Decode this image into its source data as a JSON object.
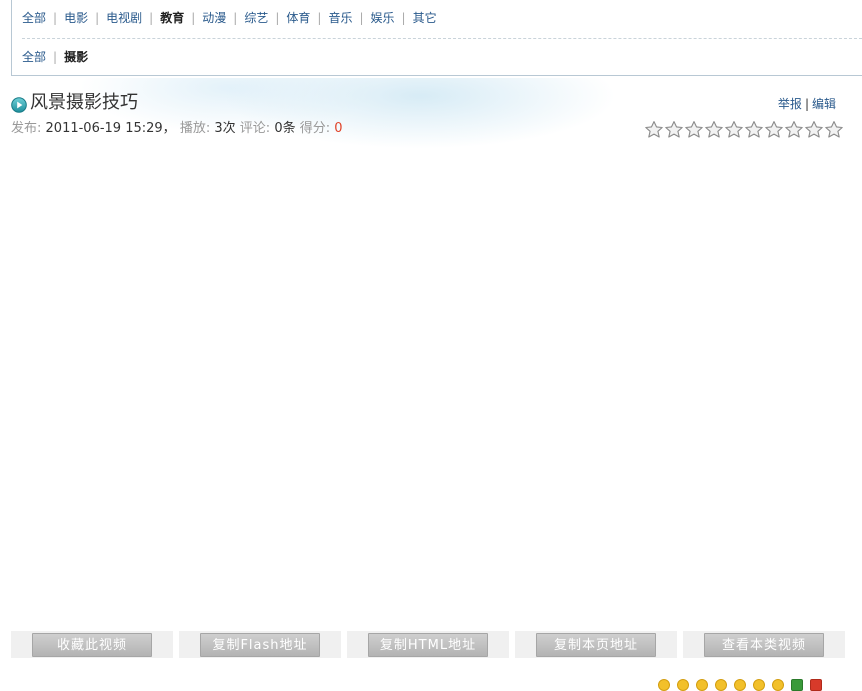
{
  "categories": {
    "row1": [
      {
        "label": "全部",
        "active": false
      },
      {
        "label": "电影",
        "active": false
      },
      {
        "label": "电视剧",
        "active": false
      },
      {
        "label": "教育",
        "active": true
      },
      {
        "label": "动漫",
        "active": false
      },
      {
        "label": "综艺",
        "active": false
      },
      {
        "label": "体育",
        "active": false
      },
      {
        "label": "音乐",
        "active": false
      },
      {
        "label": "娱乐",
        "active": false
      },
      {
        "label": "其它",
        "active": false
      }
    ],
    "row2": [
      {
        "label": "全部",
        "active": false
      },
      {
        "label": "摄影",
        "active": true
      }
    ],
    "separator": "|"
  },
  "video": {
    "title": "风景摄影技巧",
    "publish_label": "发布:",
    "publish_value": "2011-06-19 15:29，",
    "plays_label": "播放:",
    "plays_value": "3次",
    "comments_label": "评论:",
    "comments_value": "0条",
    "score_label": "得分:",
    "score_value": "0"
  },
  "actions": {
    "report": "举报",
    "separator": "|",
    "edit": "编辑"
  },
  "rating": {
    "max": 10,
    "value": 0
  },
  "buttons": [
    {
      "label": "收藏此视频"
    },
    {
      "label": "复制Flash地址"
    },
    {
      "label": "复制HTML地址"
    },
    {
      "label": "复制本页地址"
    },
    {
      "label": "查看本类视频"
    }
  ],
  "colors": {
    "link": "#2a5a8c",
    "score": "#e0442a",
    "button_gray": "#bdbdbd"
  }
}
